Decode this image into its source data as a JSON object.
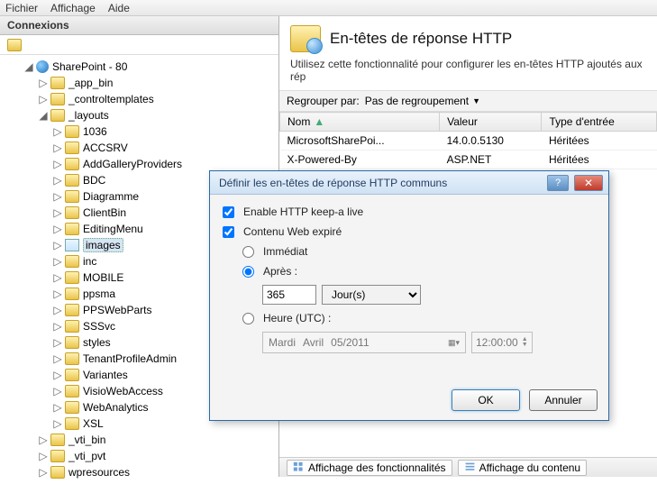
{
  "menubar": {
    "file": "Fichier",
    "display": "Affichage",
    "help": "Aide"
  },
  "left_panel": {
    "title": "Connexions",
    "root": "SharePoint - 80",
    "children": [
      {
        "name": "_app_bin",
        "expanded": false
      },
      {
        "name": "_controltemplates",
        "expanded": false
      }
    ],
    "layouts_label": "_layouts",
    "layouts": [
      "1036",
      "ACCSRV",
      "AddGalleryProviders",
      "BDC",
      "Diagramme",
      "ClientBin",
      "EditingMenu",
      "images",
      "inc",
      "MOBILE",
      "ppsma",
      "PPSWebParts",
      "SSSvc",
      "styles",
      "TenantProfileAdmin",
      "Variantes",
      "VisioWebAccess",
      "WebAnalytics",
      "XSL"
    ],
    "siblings": [
      "_vti_bin",
      "_vti_pvt",
      "wpresources"
    ]
  },
  "right_panel": {
    "title": "En-têtes de réponse HTTP",
    "description": "Utilisez cette fonctionnalité pour configurer les en-têtes HTTP ajoutés aux rép",
    "group_by_label": "Regrouper par:",
    "group_by_value": "Pas de regroupement",
    "columns": {
      "name": "Nom",
      "value": "Valeur",
      "type": "Type d'entrée"
    },
    "rows": [
      {
        "name": "MicrosoftSharePoi...",
        "value": "14.0.0.5130",
        "type": "Héritées"
      },
      {
        "name": "X-Powered-By",
        "value": "ASP.NET",
        "type": "Héritées"
      }
    ]
  },
  "dialog": {
    "title": "Définir les en-têtes de réponse HTTP communs",
    "keep_alive": "Enable HTTP keep-a live",
    "web_expire": "Contenu Web expiré",
    "immediate": "Immédiat",
    "after": "Après :",
    "after_value": "365",
    "after_unit": "Jour(s)",
    "utc": "Heure (UTC) :",
    "date_day": "Mardi",
    "date_month": "Avril",
    "date_rest": "05/2011",
    "time": "12:00:00",
    "ok": "OK",
    "cancel": "Annuler"
  },
  "tabs": {
    "features": "Affichage des fonctionnalités",
    "content": "Affichage du contenu"
  }
}
